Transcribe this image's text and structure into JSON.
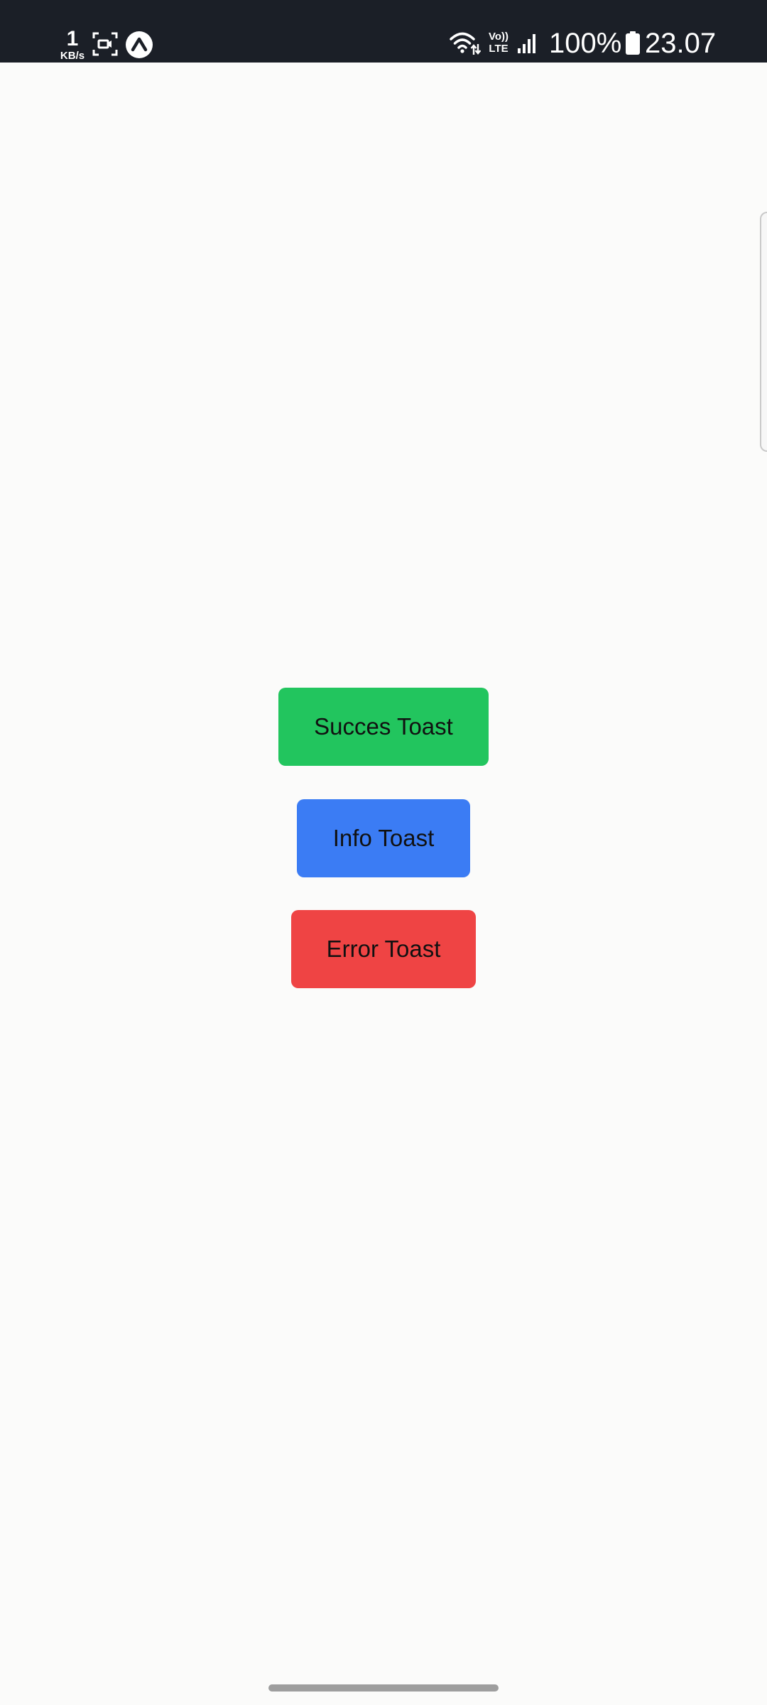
{
  "status_bar": {
    "net_speed_value": "1",
    "net_speed_unit": "KB/s",
    "volte_top": "Vo))",
    "volte_bottom": "LTE",
    "battery_percent": "100%",
    "time": "23.07",
    "icons": [
      "screen-record-icon",
      "expo-icon",
      "wifi-icon",
      "volte-icon",
      "signal-icon",
      "battery-icon"
    ]
  },
  "buttons": {
    "success": {
      "label": "Succes Toast",
      "color": "#22c55e"
    },
    "info": {
      "label": "Info Toast",
      "color": "#3b7cf4"
    },
    "error": {
      "label": "Error Toast",
      "color": "#ef4444"
    }
  },
  "colors": {
    "background": "#fbfbfa",
    "status_bar": "#1b1f27"
  }
}
